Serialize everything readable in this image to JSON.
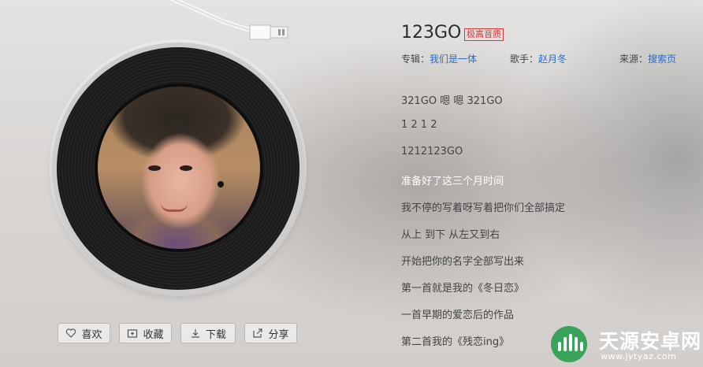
{
  "song": {
    "title": "123GO",
    "quality_badge": "极高音质",
    "album_label": "专辑：",
    "album_name": "我们是一体",
    "artist_label": "歌手：",
    "artist_name": "赵月冬",
    "source_label": "来源：",
    "source_name": "搜索页"
  },
  "actions": {
    "like": "喜欢",
    "collect": "收藏",
    "download": "下载",
    "share": "分享"
  },
  "lyrics": [
    "321GO 嗯 嗯 321GO",
    "1 2 1 2",
    "1212123GO",
    "准备好了这三个月时间",
    "我不停的写着呀写着把你们全部搞定",
    "从上 到下 从左又到右",
    "开始把你的名字全部写出来",
    "第一首就是我的《冬日恋》",
    "一首早期的爱恋后的作品",
    "第二首我的《残恋ing》"
  ],
  "highlighted_lyric_index": 3,
  "watermark": {
    "name": "天源安卓网",
    "url": "www.jytyaz.com"
  },
  "colors": {
    "link": "#2c6cbf",
    "badge": "#d13a3a",
    "watermark_green": "#3aa35a"
  },
  "icons": [
    "heart-icon",
    "add-folder-icon",
    "download-icon",
    "share-icon",
    "tonearm-icon",
    "vinyl-disc"
  ]
}
